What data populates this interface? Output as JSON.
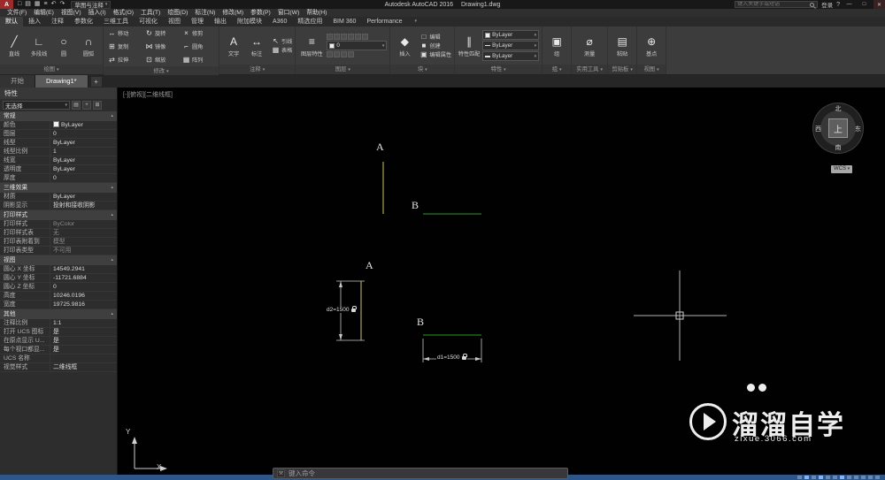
{
  "ui": {
    "chev": "▾",
    "sec_chev": "▴"
  },
  "window": {
    "min": "—",
    "max": "□",
    "close": "✕"
  },
  "titlebar": {
    "logo": "A",
    "qat": [
      "□",
      "▤",
      "▦",
      "≡",
      "↶",
      "↷"
    ],
    "workspace": "草图与注释",
    "title_app": "Autodesk AutoCAD 2016",
    "title_doc": "Drawing1.dwg",
    "search_placeholder": "键入关键字或短语",
    "signin": "登录",
    "help": "?"
  },
  "menubar": [
    "文件(F)",
    "编辑(E)",
    "视图(V)",
    "插入(I)",
    "格式(O)",
    "工具(T)",
    "绘图(D)",
    "标注(N)",
    "修改(M)",
    "参数(P)",
    "窗口(W)",
    "帮助(H)"
  ],
  "ribbon": {
    "active_tab": "默认",
    "tabs": [
      "默认",
      "插入",
      "注释",
      "参数化",
      "三维工具",
      "可视化",
      "视图",
      "管理",
      "输出",
      "附加模块",
      "A360",
      "精选应用",
      "BIM 360",
      "Performance"
    ],
    "draw": {
      "label": "绘图",
      "buttons": [
        {
          "g": "╱",
          "label": "直线"
        },
        {
          "g": "∟",
          "label": "多段线"
        },
        {
          "g": "○",
          "label": "圆"
        },
        {
          "g": "∩",
          "label": "圆弧"
        }
      ]
    },
    "modify": {
      "label": "修改",
      "buttons": [
        {
          "g": "↔",
          "label": "移动"
        },
        {
          "g": "↻",
          "label": "旋转"
        },
        {
          "g": "×",
          "label": "修剪"
        },
        {
          "g": "⊞",
          "label": "复制"
        },
        {
          "g": "⋈",
          "label": "镜像"
        },
        {
          "g": "⌐",
          "label": "圆角"
        },
        {
          "g": "⇄",
          "label": "拉伸"
        },
        {
          "g": "⊡",
          "label": "缩放"
        },
        {
          "g": "▦",
          "label": "阵列"
        }
      ]
    },
    "annotate": {
      "label": "注释",
      "big": [
        {
          "g": "A",
          "label": "文字"
        },
        {
          "g": "↔",
          "label": "标注"
        }
      ],
      "small": [
        {
          "g": "↖",
          "label": "引线"
        },
        {
          "g": "▦",
          "label": "表格"
        }
      ]
    },
    "layers": {
      "label": "图层",
      "big_glyph": "≡",
      "big_label": "图层特性",
      "current": "0"
    },
    "block": {
      "label": "块",
      "big_glyph": "◆",
      "big_label": "插入",
      "small": [
        {
          "g": "□",
          "label": "编辑"
        },
        {
          "g": "■",
          "label": "创建"
        },
        {
          "g": "▣",
          "label": "编辑属性"
        }
      ]
    },
    "properties": {
      "label": "特性",
      "match_glyph": "∥",
      "match_label": "特性匹配",
      "dropdowns": [
        "ByLayer",
        "ByLayer",
        "ByLayer"
      ]
    },
    "groups": {
      "label": "组",
      "buttons": [
        {
          "g": "▣",
          "label": "组"
        }
      ]
    },
    "utilities": {
      "label": "实用工具",
      "buttons": [
        {
          "g": "⌀",
          "label": "测量"
        }
      ]
    },
    "clipboard": {
      "label": "剪贴板",
      "buttons": [
        {
          "g": "▤",
          "label": "粘贴"
        }
      ]
    },
    "view": {
      "label": "视图",
      "buttons": [
        {
          "g": "⊕",
          "label": "基点"
        }
      ]
    }
  },
  "filetabs": {
    "tabs": [
      "开始",
      "Drawing1*"
    ],
    "active": "Drawing1*",
    "new_tab": "+"
  },
  "props": {
    "title": "特性",
    "selector": "无选择",
    "sel_icons": [
      "▤",
      "+",
      "⊞"
    ],
    "general": {
      "name": "常规",
      "rows": [
        [
          "颜色",
          "ByLayer"
        ],
        [
          "图层",
          "0"
        ],
        [
          "线型",
          "ByLayer"
        ],
        [
          "线型比例",
          "1"
        ],
        [
          "线宽",
          "ByLayer"
        ],
        [
          "透明度",
          "ByLayer"
        ],
        [
          "厚度",
          "0"
        ]
      ]
    },
    "fx": {
      "name": "三维效果",
      "rows": [
        [
          "材质",
          "ByLayer"
        ],
        [
          "阴影显示",
          "投射和接收阴影"
        ]
      ]
    },
    "plot": {
      "name": "打印样式",
      "rows": [
        [
          "打印样式",
          "ByColor"
        ],
        [
          "打印样式表",
          "无"
        ],
        [
          "打印表附着到",
          "模型"
        ],
        [
          "打印表类型",
          "不可用"
        ]
      ]
    },
    "view": {
      "name": "视图",
      "rows": [
        [
          "圆心 X 坐标",
          "14549.2941"
        ],
        [
          "圆心 Y 坐标",
          "-11721.6884"
        ],
        [
          "圆心 Z 坐标",
          "0"
        ],
        [
          "高度",
          "10246.0196"
        ],
        [
          "宽度",
          "19725.9816"
        ]
      ]
    },
    "misc": {
      "name": "其他",
      "rows": [
        [
          "注释比例",
          "1:1"
        ],
        [
          "打开 UCS 图标",
          "是"
        ],
        [
          "在原点显示 U...",
          "是"
        ],
        [
          "每个视口都显...",
          "是"
        ],
        [
          "UCS 名称",
          ""
        ],
        [
          "视觉样式",
          "二维线框"
        ]
      ]
    }
  },
  "canvas": {
    "viewport_label": "[-][俯视][二维线框]",
    "label_a": "A",
    "label_b": "B",
    "dim_d2": "d2=1500",
    "dim_d1": "d1=1500",
    "colors": {
      "object_yellow": "#cbcb3a",
      "object_green": "#22a022",
      "dimension": "#c8c8c8",
      "crosshair": "#b4b4b4"
    },
    "viewcube": {
      "n": "北",
      "s": "南",
      "e": "东",
      "w": "西",
      "top": "上",
      "wcs": "WCS"
    },
    "ucs": {
      "x": "X",
      "y": "Y"
    },
    "watermark": {
      "name": "溜溜自学",
      "url": "zixue.3066.com"
    }
  },
  "cmd": {
    "prompt": "键入命令"
  }
}
